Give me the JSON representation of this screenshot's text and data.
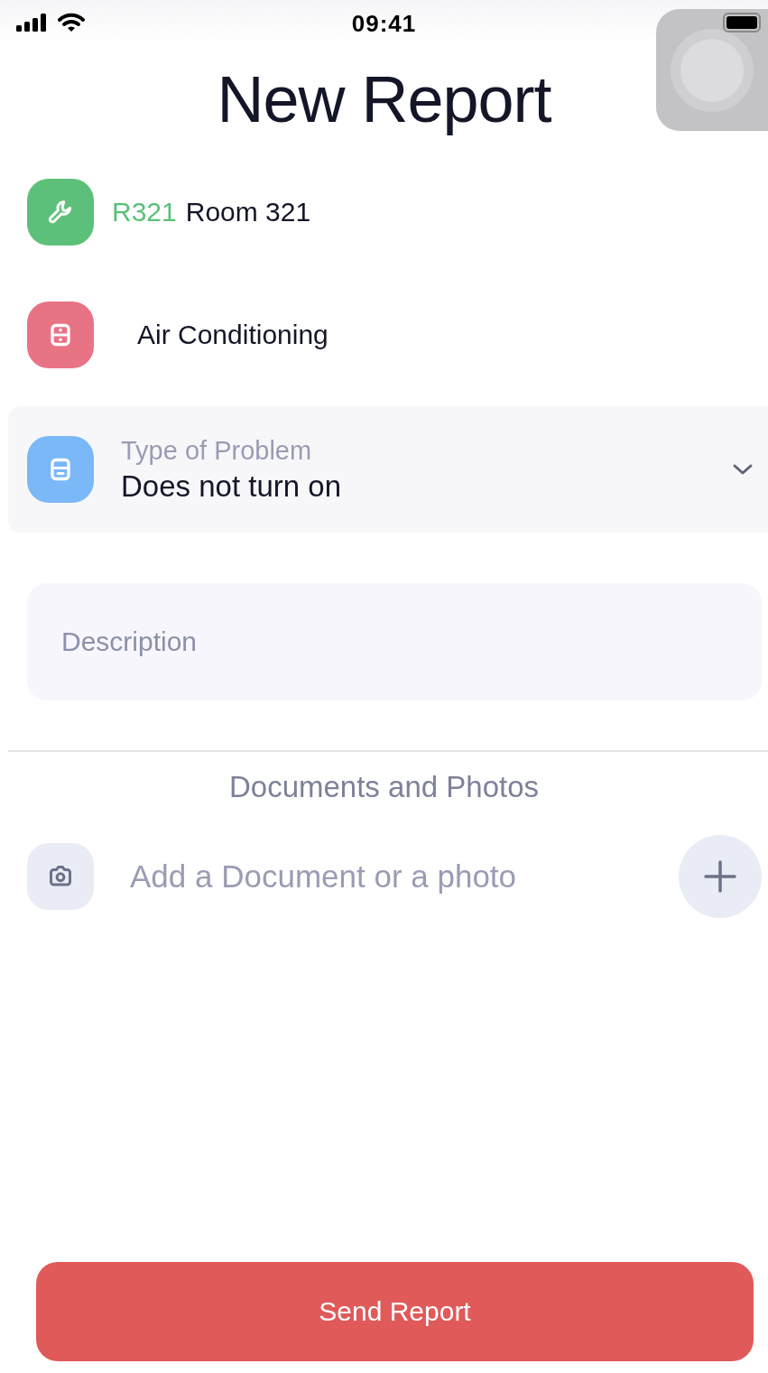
{
  "status_bar": {
    "time": "09:41"
  },
  "title": "New Report",
  "room": {
    "code": "R321",
    "name": "Room 321"
  },
  "category": {
    "label": "Air Conditioning"
  },
  "problem": {
    "label": "Type of Problem",
    "value": "Does not turn on"
  },
  "description": {
    "placeholder": "Description"
  },
  "documents": {
    "heading": "Documents and Photos",
    "prompt": "Add a Document or a photo"
  },
  "submit": "Send Report"
}
